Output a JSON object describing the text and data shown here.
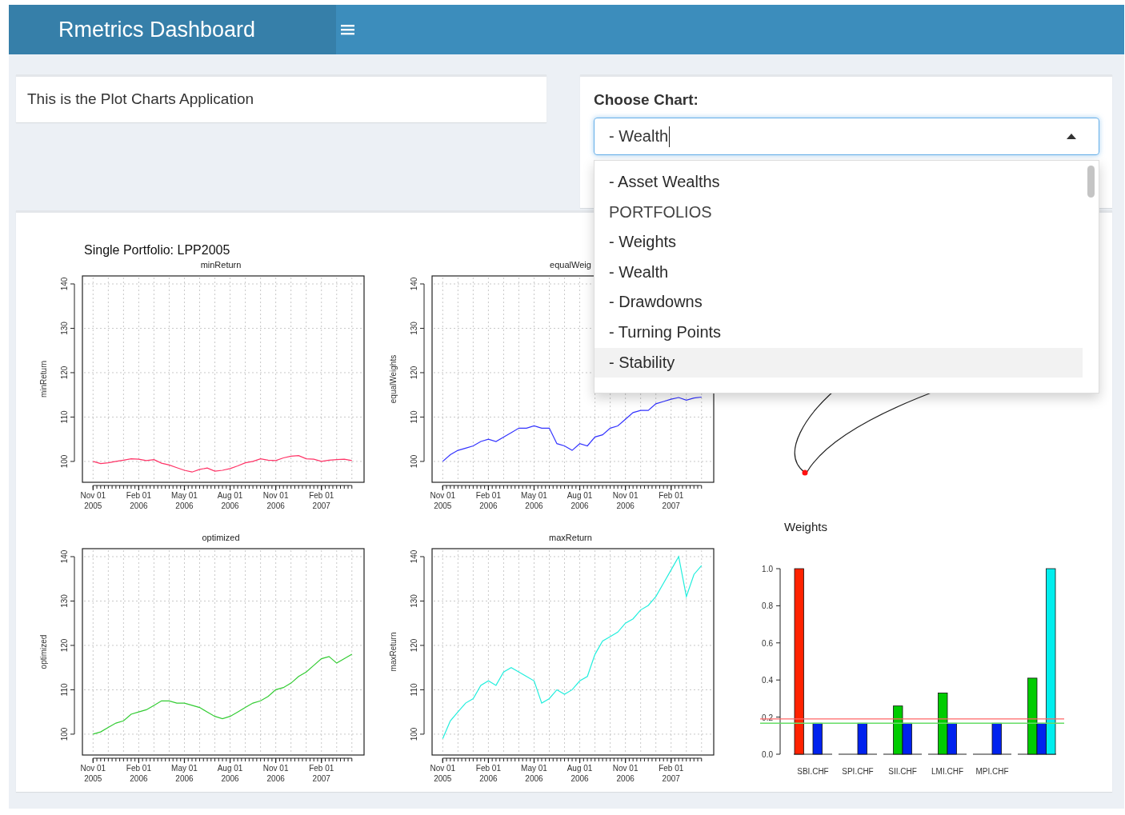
{
  "header": {
    "title": "Rmetrics Dashboard"
  },
  "intro": {
    "text": "This is the Plot Charts Application"
  },
  "chooser": {
    "label": "Choose Chart:",
    "value": "- Wealth",
    "expanded": true,
    "options": [
      {
        "label": "- Asset Wealths",
        "kind": "option",
        "highlighted": false
      },
      {
        "label": "PORTFOLIOS",
        "kind": "group",
        "highlighted": false
      },
      {
        "label": "- Weights",
        "kind": "option",
        "highlighted": false
      },
      {
        "label": "- Wealth",
        "kind": "option",
        "highlighted": false
      },
      {
        "label": "- Drawdowns",
        "kind": "option",
        "highlighted": false
      },
      {
        "label": "- Turning Points",
        "kind": "option",
        "highlighted": false
      },
      {
        "label": "- Stability",
        "kind": "option",
        "highlighted": true
      }
    ]
  },
  "plot": {
    "title": "Single Portfolio: LPP2005",
    "series_charts": [
      {
        "chart_data": {
          "type": "line",
          "title": "minReturn",
          "ylabel": "minReturn",
          "grid": true,
          "categories": [
            "Nov 01\n2005",
            null,
            null,
            null,
            null,
            null,
            "Feb 01\n2006",
            null,
            null,
            null,
            null,
            null,
            "May 01\n2006",
            null,
            null,
            null,
            null,
            null,
            "Aug 01\n2006",
            null,
            null,
            null,
            null,
            null,
            "Nov 01\n2006",
            null,
            null,
            null,
            null,
            null,
            "Feb 01\n2007",
            null,
            null,
            null,
            null
          ],
          "ylim": [
            95.3,
            141.8
          ],
          "yticks": [
            100,
            110,
            120,
            130,
            140
          ],
          "series": [
            {
              "color": "#ff3366",
              "values": [
                100,
                99.5,
                99.7,
                100,
                100.3,
                100.6,
                100.5,
                100.2,
                100.4,
                99.6,
                99.2,
                98.6,
                98,
                97.6,
                98.2,
                98.5,
                97.8,
                98,
                98.4,
                99,
                99.7,
                100,
                100.6,
                100.3,
                100.2,
                100.8,
                101.2,
                101.3,
                100.6,
                100.5,
                100,
                100.3,
                100.4,
                100.5,
                100.2
              ]
            }
          ]
        }
      },
      {
        "chart_data": {
          "type": "line",
          "title": "equalWeig",
          "ylabel": "equalWeights",
          "grid": true,
          "categories": [
            "Nov 01\n2005",
            null,
            null,
            null,
            null,
            null,
            "Feb 01\n2006",
            null,
            null,
            null,
            null,
            null,
            "May 01\n2006",
            null,
            null,
            null,
            null,
            null,
            "Aug 01\n2006",
            null,
            null,
            null,
            null,
            null,
            "Nov 01\n2006",
            null,
            null,
            null,
            null,
            null,
            "Feb 01\n2007",
            null,
            null,
            null,
            null
          ],
          "ylim": [
            95.3,
            141.8
          ],
          "yticks": [
            100,
            110,
            120,
            130,
            140
          ],
          "series": [
            {
              "color": "#3333ff",
              "values": [
                100,
                101.5,
                102.5,
                103,
                103.5,
                104.5,
                105,
                104.5,
                105.5,
                106.5,
                107.5,
                107.5,
                108,
                107.5,
                107.5,
                104,
                103.5,
                102.5,
                104,
                103.5,
                105.5,
                106,
                107.5,
                108,
                109.5,
                111,
                111.5,
                111.5,
                113,
                113.5,
                114,
                114.4,
                113.8,
                114.3,
                114.5
              ]
            }
          ]
        }
      },
      {
        "chart_data": {
          "type": "line",
          "title": "optimized",
          "ylabel": "optimized",
          "grid": true,
          "categories": [
            "Nov 01\n2005",
            null,
            null,
            null,
            null,
            null,
            "Feb 01\n2006",
            null,
            null,
            null,
            null,
            null,
            "May 01\n2006",
            null,
            null,
            null,
            null,
            null,
            "Aug 01\n2006",
            null,
            null,
            null,
            null,
            null,
            "Nov 01\n2006",
            null,
            null,
            null,
            null,
            null,
            "Feb 01\n2007",
            null,
            null,
            null,
            null
          ],
          "ylim": [
            95.3,
            141.8
          ],
          "yticks": [
            100,
            110,
            120,
            130,
            140
          ],
          "series": [
            {
              "color": "#33cc33",
              "values": [
                100,
                100.5,
                101.5,
                102.5,
                103,
                104.5,
                105,
                105.5,
                106.5,
                107.5,
                107.5,
                107,
                107,
                106.5,
                106,
                105,
                104,
                103.5,
                104,
                105,
                106,
                107,
                107.5,
                108.5,
                110,
                110.5,
                111.5,
                113,
                114,
                115.5,
                117,
                117.5,
                116,
                117,
                118
              ]
            }
          ]
        }
      },
      {
        "chart_data": {
          "type": "line",
          "title": "maxReturn",
          "ylabel": "maxReturn",
          "grid": true,
          "categories": [
            "Nov 01\n2005",
            null,
            null,
            null,
            null,
            null,
            "Feb 01\n2006",
            null,
            null,
            null,
            null,
            null,
            "May 01\n2006",
            null,
            null,
            null,
            null,
            null,
            "Aug 01\n2006",
            null,
            null,
            null,
            null,
            null,
            "Nov 01\n2006",
            null,
            null,
            null,
            null,
            null,
            "Feb 01\n2007",
            null,
            null,
            null,
            null
          ],
          "ylim": [
            95.3,
            141.8
          ],
          "yticks": [
            100,
            110,
            120,
            130,
            140
          ],
          "series": [
            {
              "color": "#22eedd",
              "values": [
                99,
                103,
                105,
                107,
                108,
                111,
                112,
                111,
                114,
                115,
                114,
                113,
                112,
                107,
                108,
                110,
                109,
                110,
                112,
                113,
                118,
                121,
                122,
                123,
                125,
                126,
                128,
                129,
                131,
                134,
                137,
                140,
                131,
                136,
                138
              ]
            }
          ]
        }
      }
    ],
    "weights": {
      "chart_data": {
        "type": "bar",
        "title": "Weights",
        "categories": [
          "SBI.CHF",
          "SPI.CHF",
          "SII.CHF",
          "LMI.CHF",
          "MPI.CHF",
          null
        ],
        "ylim": [
          0,
          1
        ],
        "yticks": [
          {
            "value": 0,
            "label": "0.0"
          },
          {
            "value": 0.2,
            "label": "0.2"
          },
          {
            "value": 0.4,
            "label": "0.4"
          },
          {
            "value": 0.6,
            "label": "0.6"
          },
          {
            "value": 0.8,
            "label": "0.8"
          },
          {
            "value": 1,
            "label": "1.0"
          }
        ],
        "series": [
          {
            "color": "#ff2200",
            "values": [
              1,
              0,
              0,
              0,
              0,
              0
            ]
          },
          {
            "color": "#00cc00",
            "values": [
              0,
              0,
              0.26,
              0.33,
              0,
              0.41
            ]
          },
          {
            "color": "#0022ee",
            "values": [
              0.167,
              0.167,
              0.167,
              0.167,
              0.167,
              0.167
            ]
          },
          {
            "color": "#00eeee",
            "values": [
              0,
              0,
              0,
              0,
              0,
              1
            ]
          }
        ],
        "ref_lines": [
          {
            "axis": "y",
            "value": 0.19,
            "color": "#ff6666"
          },
          {
            "axis": "y",
            "value": 0.167,
            "color": "#66dd66"
          }
        ]
      }
    }
  }
}
